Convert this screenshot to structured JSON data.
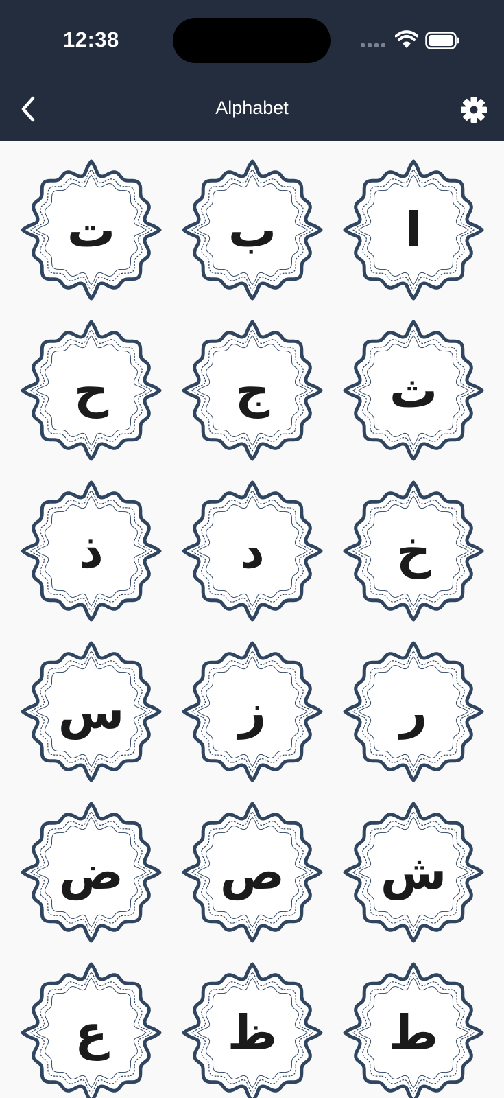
{
  "status_bar": {
    "time": "12:38"
  },
  "header": {
    "title": "Alphabet",
    "back_icon": "chevron-left-icon",
    "settings_icon": "gear-icon"
  },
  "colors": {
    "header_bg": "#232d3e",
    "frame": "#2f4560",
    "page_bg": "#f9f9f9"
  },
  "letters": [
    [
      "ت",
      "ب",
      "ا"
    ],
    [
      "ح",
      "ج",
      "ث"
    ],
    [
      "ذ",
      "د",
      "خ"
    ],
    [
      "س",
      "ز",
      "ر"
    ],
    [
      "ض",
      "ص",
      "ش"
    ],
    [
      "ع",
      "ظ",
      "ط"
    ]
  ]
}
